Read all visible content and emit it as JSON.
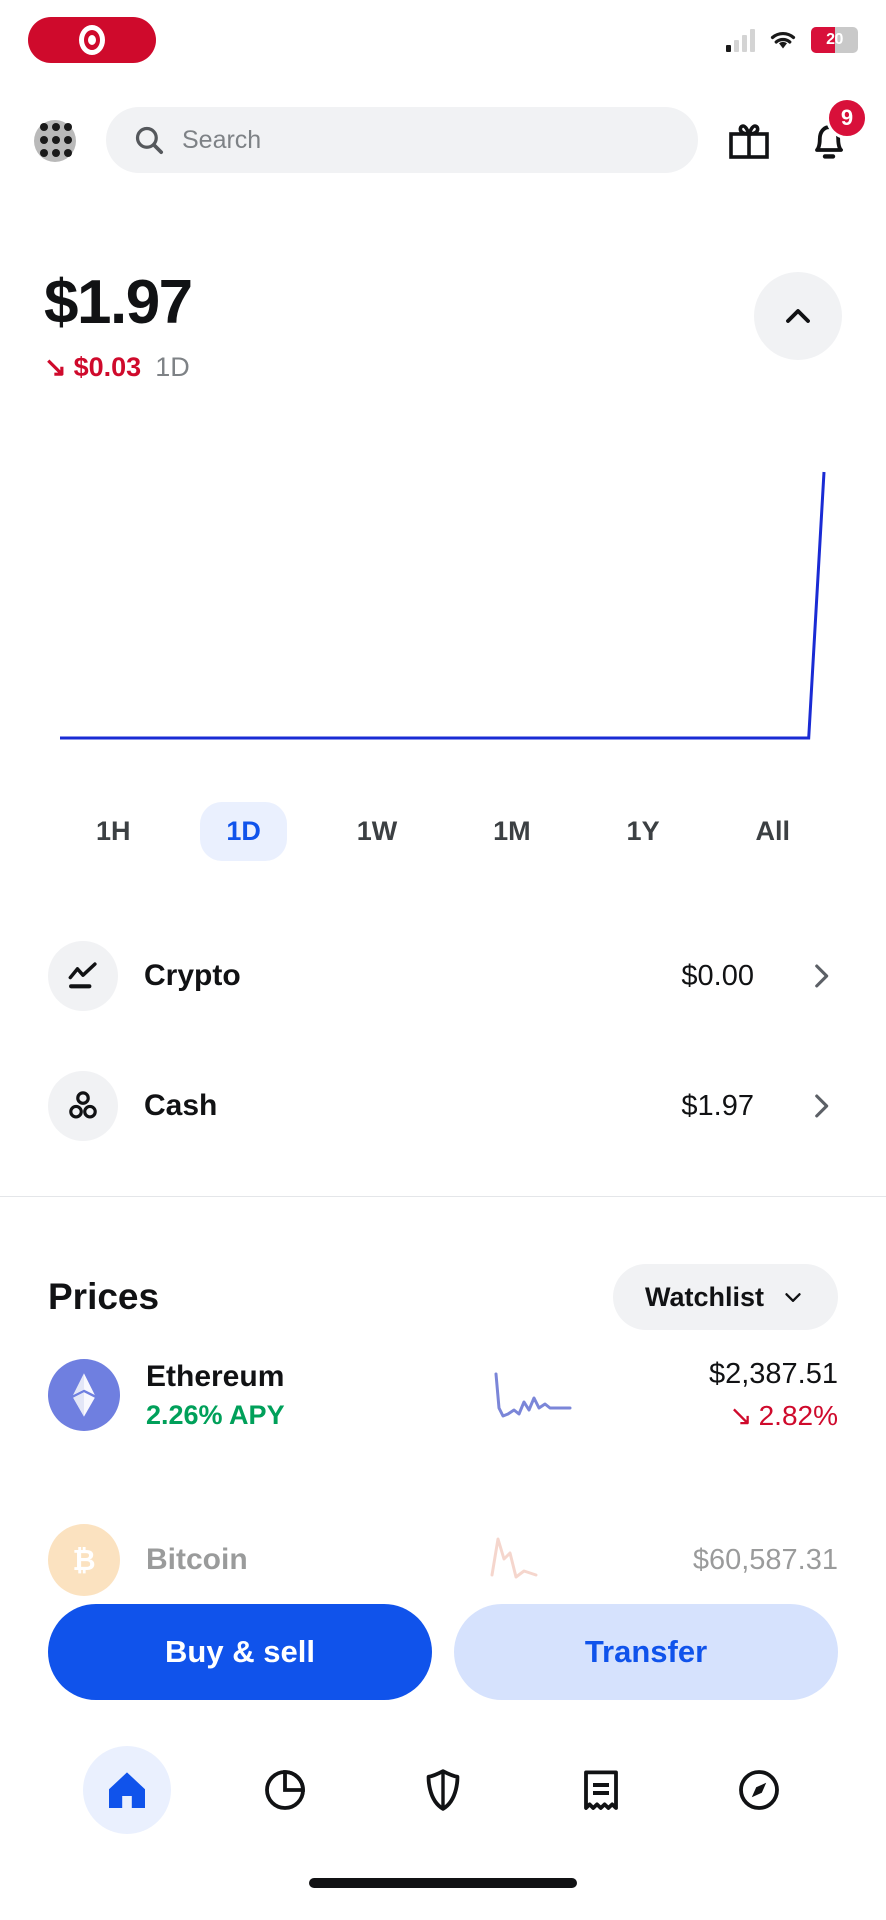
{
  "status_bar": {
    "recording_icon": "record-icon",
    "signal_icon": "cellular-signal-icon",
    "wifi_icon": "wifi-icon",
    "battery_percent": "20",
    "battery_charging": true
  },
  "header": {
    "grid_icon": "app-grid-icon",
    "search": {
      "placeholder": "Search",
      "icon": "search-icon",
      "value": ""
    },
    "gift_icon": "gift-icon",
    "bell_icon": "bell-icon",
    "notification_count": "9"
  },
  "balance": {
    "amount": "$1.97",
    "change_arrow": "↘",
    "change_amount": "$0.03",
    "period": "1D",
    "change_color": "#cf0a2c",
    "collapse_icon": "chevron-up-icon"
  },
  "ranges": [
    {
      "label": "1H",
      "selected": false
    },
    {
      "label": "1D",
      "selected": true
    },
    {
      "label": "1W",
      "selected": false
    },
    {
      "label": "1M",
      "selected": false
    },
    {
      "label": "1Y",
      "selected": false
    },
    {
      "label": "All",
      "selected": false
    }
  ],
  "accounts": [
    {
      "name": "Crypto",
      "value": "$0.00",
      "icon": "line-chart-icon"
    },
    {
      "name": "Cash",
      "value": "$1.97",
      "icon": "three-circles-icon"
    }
  ],
  "prices": {
    "title": "Prices",
    "watchlist_label": "Watchlist",
    "watchlist_caret": "chevron-down-icon",
    "coins": [
      {
        "name": "Ethereum",
        "apy": "2.26% APY",
        "price": "$2,387.51",
        "change_arrow": "↘",
        "change": "2.82%",
        "logo": "ethereum-logo",
        "logo_color": "#6f7fe0",
        "sparkline_color": "#7b86d8",
        "faded": false
      },
      {
        "name": "Bitcoin",
        "apy": "",
        "price": "$60,587.31",
        "change_arrow": "",
        "change": "",
        "logo": "bitcoin-logo",
        "logo_color": "#f7bb6a",
        "sparkline_color": "#e9a08a",
        "faded": true
      }
    ]
  },
  "actions": {
    "buy_sell_label": "Buy & sell",
    "transfer_label": "Transfer",
    "primary_color": "#1053eb",
    "secondary_color": "#d6e2fd"
  },
  "bottom_nav": [
    {
      "icon": "home-icon",
      "active": true
    },
    {
      "icon": "pie-chart-icon",
      "active": false
    },
    {
      "icon": "shield-icon",
      "active": false
    },
    {
      "icon": "receipt-icon",
      "active": false
    },
    {
      "icon": "compass-icon",
      "active": false
    }
  ],
  "chart_data": {
    "type": "line",
    "title": "",
    "xlabel": "",
    "ylabel": "",
    "line_color": "#1a2bd4",
    "x": [
      0,
      10,
      20,
      30,
      40,
      50,
      60,
      70,
      75,
      78,
      80,
      82,
      84,
      86,
      88,
      90,
      92,
      94,
      96,
      98,
      100
    ],
    "values": [
      0,
      0,
      0,
      0,
      0,
      0,
      0,
      0,
      0,
      0,
      0,
      0,
      0,
      0,
      0,
      0,
      0,
      0,
      0,
      0,
      100
    ],
    "ylim": [
      0,
      100
    ],
    "xlim": [
      0,
      100
    ],
    "grid": false,
    "legend": "none"
  }
}
